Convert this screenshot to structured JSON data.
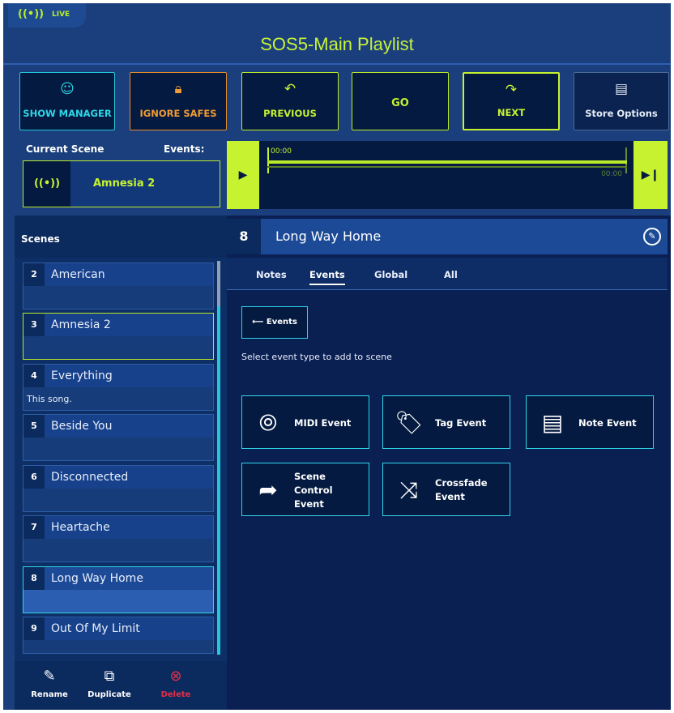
{
  "live": {
    "icon": "broadcast-icon",
    "label": "LIVE"
  },
  "title": "SOS5-Main Playlist",
  "toolbar": {
    "show_manager": "SHOW MANAGER",
    "ignore_safes": "IGNORE SAFES",
    "previous": "PREVIOUS",
    "go": "GO",
    "next": "NEXT",
    "store_options": "Store Options"
  },
  "current": {
    "label": "Current Scene",
    "events_label": "Events:",
    "scene_name": "Amnesia 2",
    "time_start": "00:00",
    "time_end": "00:00"
  },
  "scenes_panel": {
    "title": "Scenes",
    "items": [
      {
        "num": "2",
        "name": "American",
        "sub": ""
      },
      {
        "num": "3",
        "name": "Amnesia 2",
        "sub": ""
      },
      {
        "num": "4",
        "name": "Everything",
        "sub": "This song."
      },
      {
        "num": "5",
        "name": "Beside You",
        "sub": ""
      },
      {
        "num": "6",
        "name": "Disconnected",
        "sub": ""
      },
      {
        "num": "7",
        "name": "Heartache",
        "sub": ""
      },
      {
        "num": "8",
        "name": "Long Way Home",
        "sub": ""
      },
      {
        "num": "9",
        "name": "Out Of My Limit",
        "sub": ""
      }
    ],
    "actions": {
      "rename": "Rename",
      "duplicate": "Duplicate",
      "delete": "Delete"
    }
  },
  "detail": {
    "num": "8",
    "name": "Long Way Home",
    "tabs": [
      "Notes",
      "Events",
      "Global",
      "All"
    ],
    "back_label": "Events",
    "hint": "Select event type to add to scene",
    "event_types": [
      "MIDI Event",
      "Tag Event",
      "Note Event",
      "Scene Control Event",
      "Crossfade Event"
    ]
  },
  "colors": {
    "accent": "#c6f230",
    "cyan": "#2ed6e8",
    "orange": "#f29b34",
    "delete": "#e0304a",
    "bg": "#1b3f7c"
  }
}
